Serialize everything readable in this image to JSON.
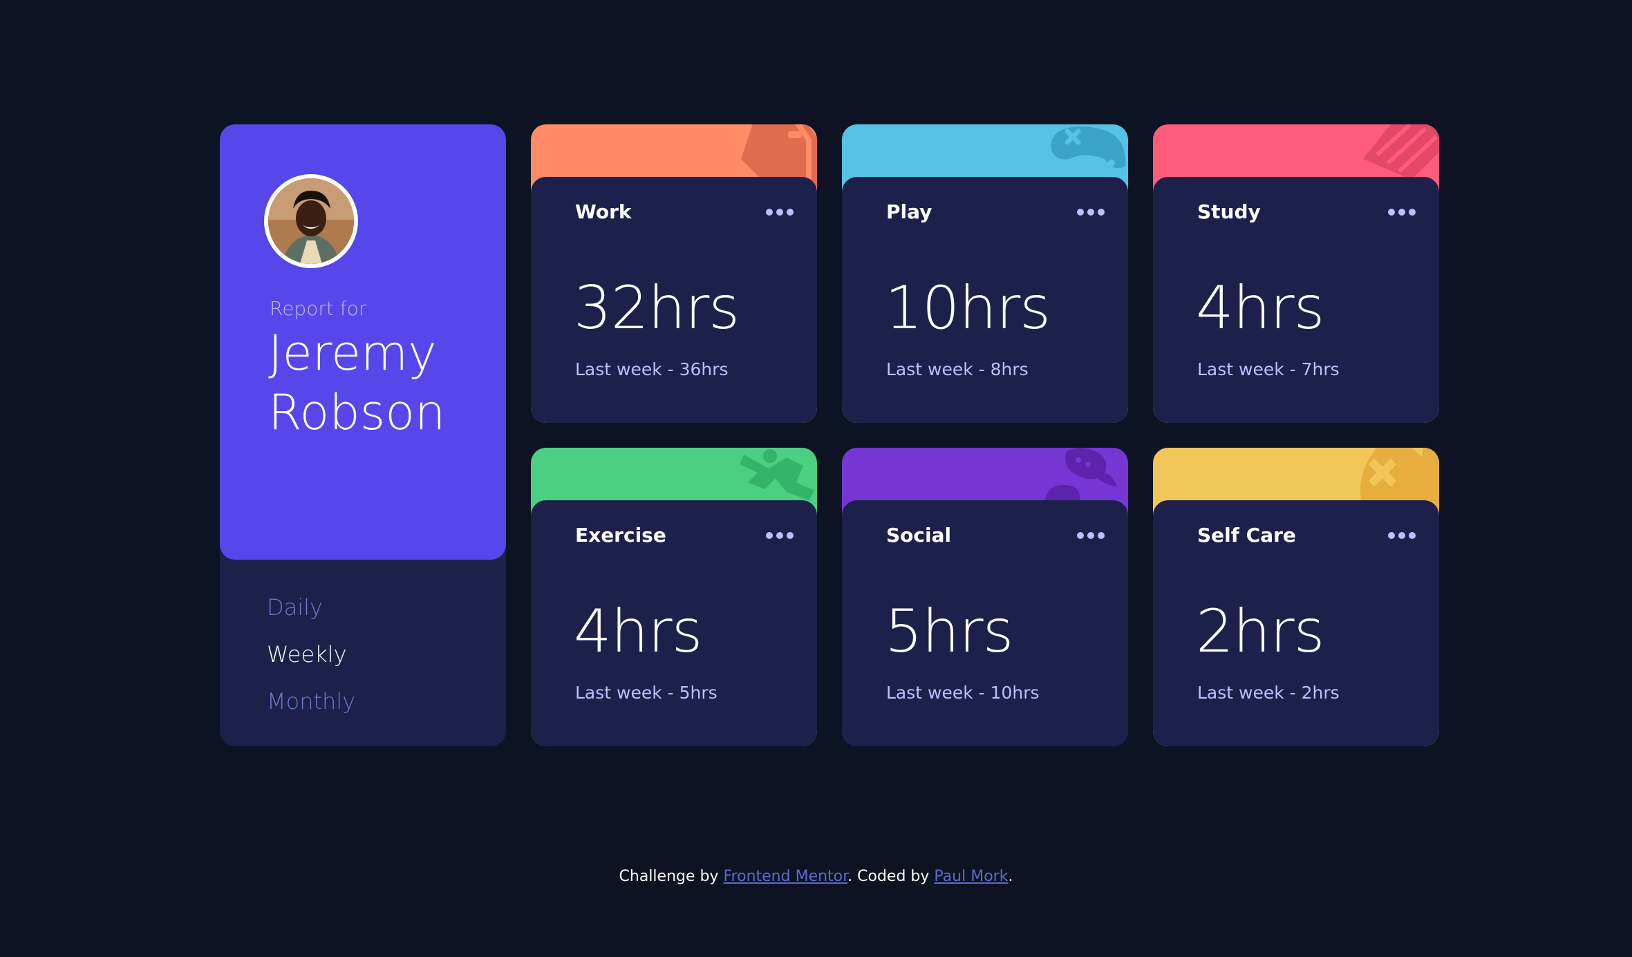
{
  "profile": {
    "report_for": "Report for",
    "name_first": "Jeremy",
    "name_last": "Robson",
    "periods": [
      "Daily",
      "Weekly",
      "Monthly"
    ],
    "active_period": "Weekly"
  },
  "cards": [
    {
      "title": "Work",
      "current": "32hrs",
      "previous": "Last week - 36hrs",
      "color": "#ff8c66",
      "icon": "briefcase-icon"
    },
    {
      "title": "Play",
      "current": "10hrs",
      "previous": "Last week - 8hrs",
      "color": "#56c2e6",
      "icon": "gamepad-icon"
    },
    {
      "title": "Study",
      "current": "4hrs",
      "previous": "Last week - 7hrs",
      "color": "#ff5c7c",
      "icon": "book-icon"
    },
    {
      "title": "Exercise",
      "current": "4hrs",
      "previous": "Last week - 5hrs",
      "color": "#4bcf83",
      "icon": "running-icon"
    },
    {
      "title": "Social",
      "current": "5hrs",
      "previous": "Last week - 10hrs",
      "color": "#7536d3",
      "icon": "chat-icon"
    },
    {
      "title": "Self Care",
      "current": "2hrs",
      "previous": "Last week - 2hrs",
      "color": "#f1c65b",
      "icon": "heart-care-icon"
    }
  ],
  "footer": {
    "challenge_by": "Challenge by",
    "frontend_mentor": "Frontend Mentor",
    "coded_by": ". Coded by",
    "author": "Paul Mork",
    "end": "."
  },
  "colors": {
    "background": "#0e1323",
    "card": "#1c204b",
    "profile_accent": "#5746ea",
    "muted_text": "#bbc0ff"
  }
}
